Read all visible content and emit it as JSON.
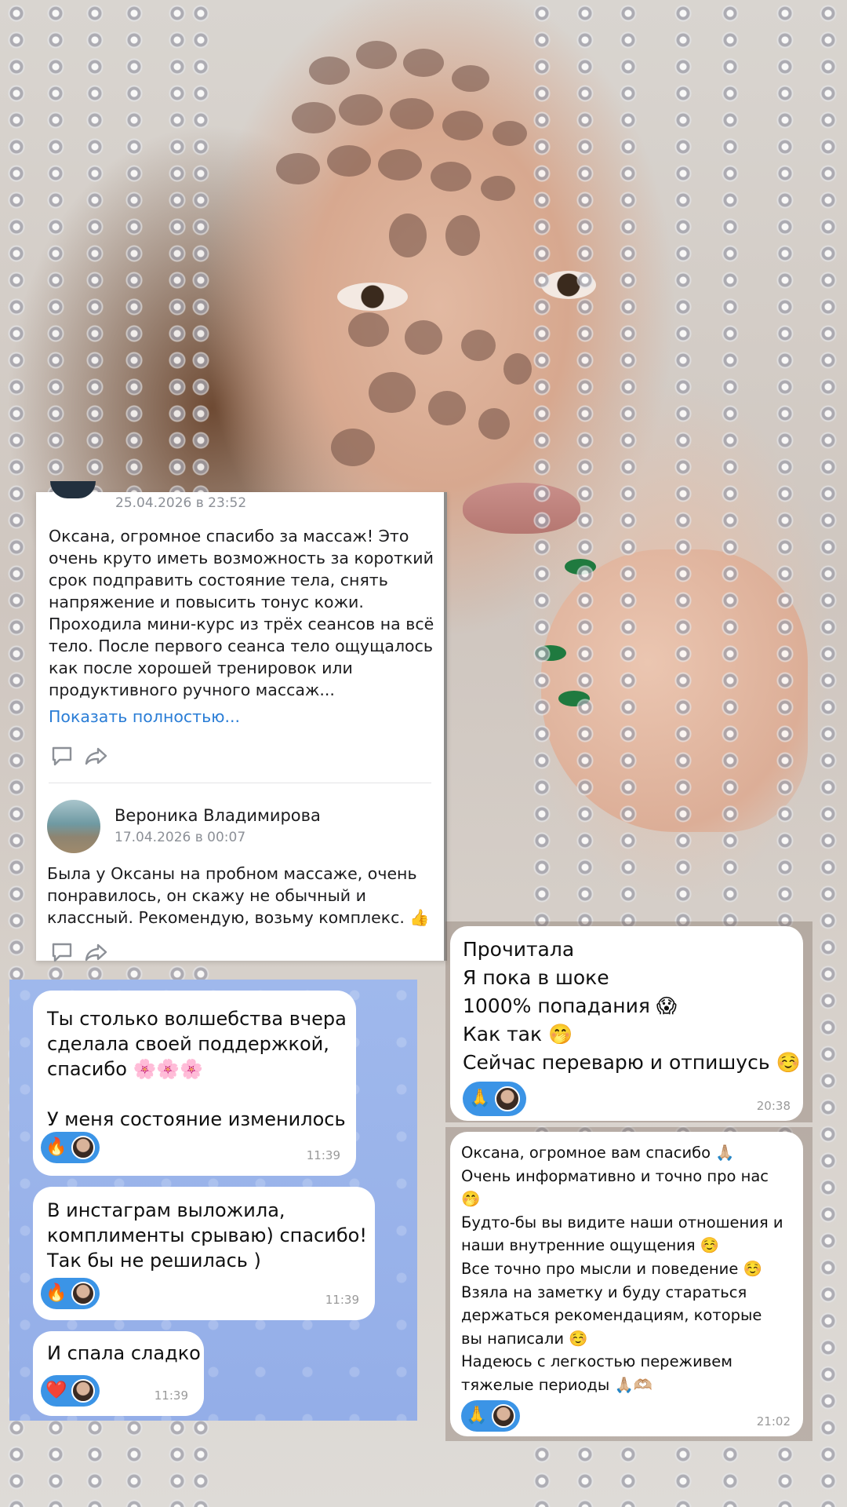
{
  "review_card": {
    "top_date": "25.04.2026 в 23:52",
    "top_review_text": "Оксана, огромное спасибо за массаж! Это очень круто иметь возможность за короткий срок подправить состояние тела, снять напряжение и повысить тонус кожи. Проходила мини-курс из трёх сеансов на всё тело. После первого сеанса тело ощущалось как после хорошей тренировок или продуктивного ручного массаж...",
    "show_more": "Показать полностью...",
    "second_review": {
      "author": "Вероника Владимирова",
      "date": "17.04.2026 в 00:07",
      "text": "Была у Оксаны на пробном массаже, очень понравилось, он скажу не обычный и классный. Рекомендую, возьму комплекс. 👍"
    }
  },
  "telegram_left": {
    "messages": [
      {
        "text_lines": [
          "Ты столько волшебства вчера",
          "сделала своей поддержкой,",
          "спасибо 🌸🌸🌸",
          "",
          "У меня состояние изменилось"
        ],
        "reaction": "🔥",
        "time": "11:39"
      },
      {
        "text_lines": [
          "В инстаграм выложила,",
          "комплименты срываю) спасибо!",
          "Так бы не решилась )"
        ],
        "reaction": "🔥",
        "time": "11:39"
      },
      {
        "text_lines": [
          "И спала сладко"
        ],
        "reaction": "❤️",
        "time": "11:39"
      }
    ]
  },
  "chat_right_top": {
    "lines": [
      "Прочитала",
      "Я пока в шоке",
      "1000% попадания 😱",
      "Как так 🤭",
      "Сейчас переварю и отпишусь ☺️"
    ],
    "reaction": "🙏",
    "time": "20:38"
  },
  "chat_right_bottom": {
    "lines": [
      "Оксана, огромное вам спасибо 🙏🏼",
      "Очень информативно и точно про нас",
      "🤭",
      "Будто-бы вы видите наши отношения и",
      "наши внутренние ощущения ☺️",
      "Все точно про мысли и поведение ☺️",
      "Взяла на заметку и буду стараться",
      "держаться рекомендациям, которые",
      "вы написали ☺️",
      "Надеюсь с легкостью переживем",
      "тяжелые периоды 🙏🏼🫶🏼"
    ],
    "reaction": "🙏",
    "time": "21:02"
  },
  "colors": {
    "link": "#2a7dd6",
    "telegram_bg": "#9fb8ec",
    "reaction_bg": "#3b94e6"
  }
}
